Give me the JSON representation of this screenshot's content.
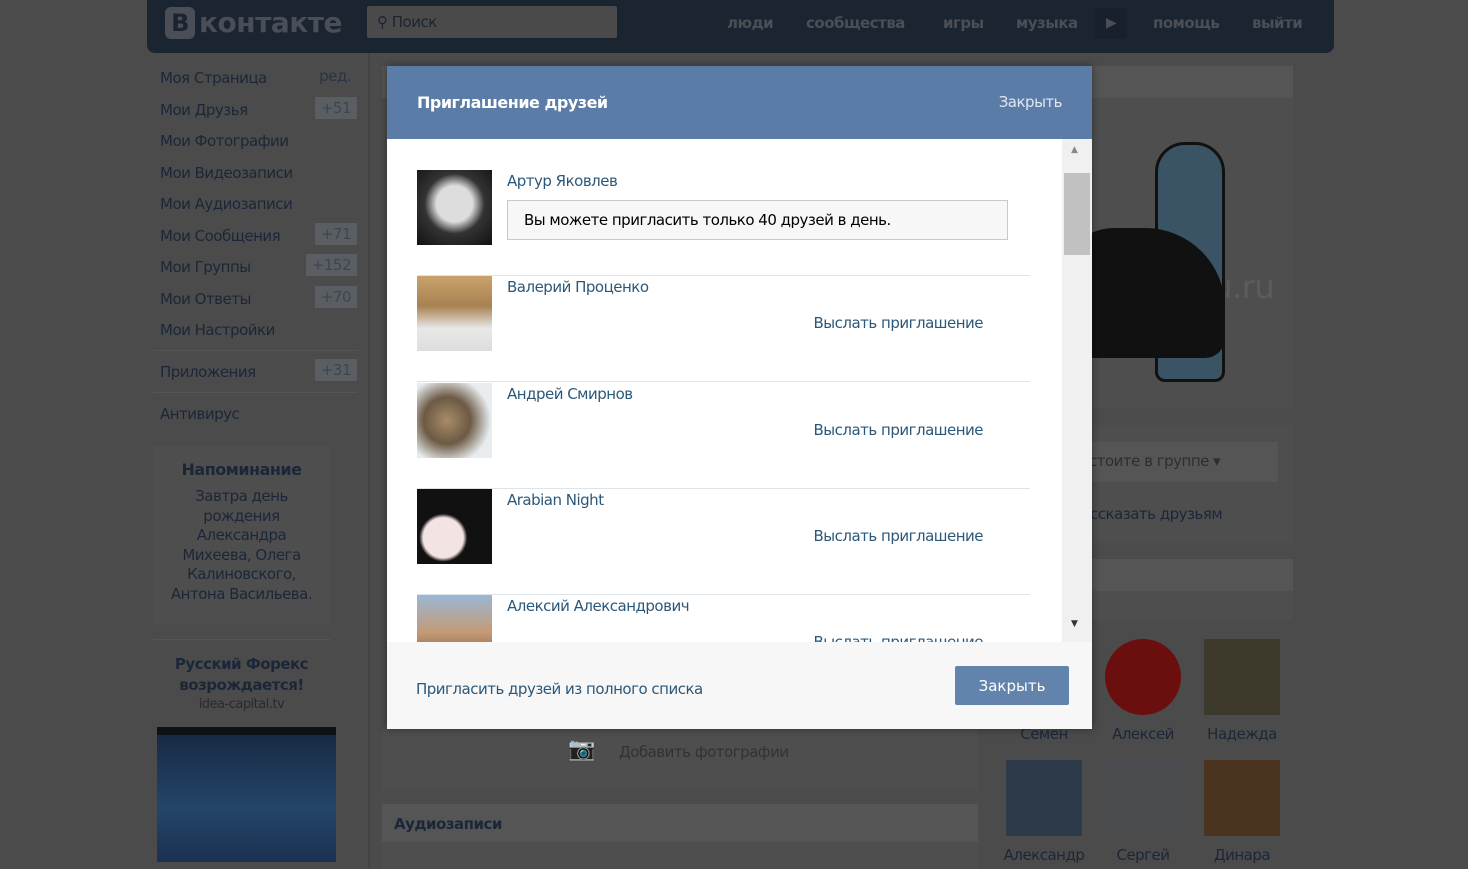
{
  "header": {
    "logo": "контакте",
    "logo_letter": "В",
    "search_placeholder": "Поиск",
    "nav": [
      "люди",
      "сообщества",
      "игры",
      "музыка",
      "помощь",
      "выйти"
    ]
  },
  "sidebar": {
    "items": [
      {
        "label": "Моя Страница",
        "badge": "ред."
      },
      {
        "label": "Мои Друзья",
        "badge": "+51"
      },
      {
        "label": "Мои Фотографии"
      },
      {
        "label": "Мои Видеозаписи"
      },
      {
        "label": "Мои Аудиозаписи"
      },
      {
        "label": "Мои Сообщения",
        "badge": "+71"
      },
      {
        "label": "Мои Группы",
        "badge": "+152"
      },
      {
        "label": "Мои Ответы",
        "badge": "+70"
      },
      {
        "label": "Мои Настройки"
      },
      {
        "label": "Приложения",
        "badge": "+31"
      },
      {
        "label": "Антивирус"
      }
    ],
    "reminder": {
      "title": "Напоминание",
      "text": "Завтра день рождения Александра Михеева, Олега Калиновского, Антона Васильева."
    },
    "ad": {
      "title": "Русский Форекс возрождается!",
      "domain": "idea-capital.tv"
    }
  },
  "main": {
    "add_photos": "Добавить фотографии",
    "audio_title": "Аудиозаписи",
    "watermark": "ssrochku.ru",
    "group_status": "стоите в группе",
    "tell_friends": "ссказать друзьям"
  },
  "friends": [
    {
      "name": "Семен"
    },
    {
      "name": "Алексей"
    },
    {
      "name": "Надежда"
    },
    {
      "name": "Александр"
    },
    {
      "name": "Сергей"
    },
    {
      "name": "Динара"
    }
  ],
  "modal": {
    "title": "Приглашение друзей",
    "close_link": "Закрыть",
    "limit_notice": "Вы можете пригласить только 40 друзей в день.",
    "invite_label": "Выслать приглашение",
    "people": [
      {
        "name": "Артур Яковлев"
      },
      {
        "name": "Валерий Проценко"
      },
      {
        "name": "Андрей Смирнов"
      },
      {
        "name": "Arabian Night"
      },
      {
        "name": "Алексий Александрович"
      }
    ],
    "full_list_link": "Пригласить друзей из полного списка",
    "close_button": "Закрыть"
  },
  "colors": {
    "modal_header": "#5b7ca7",
    "link": "#2b587a",
    "button": "#6283ab"
  }
}
